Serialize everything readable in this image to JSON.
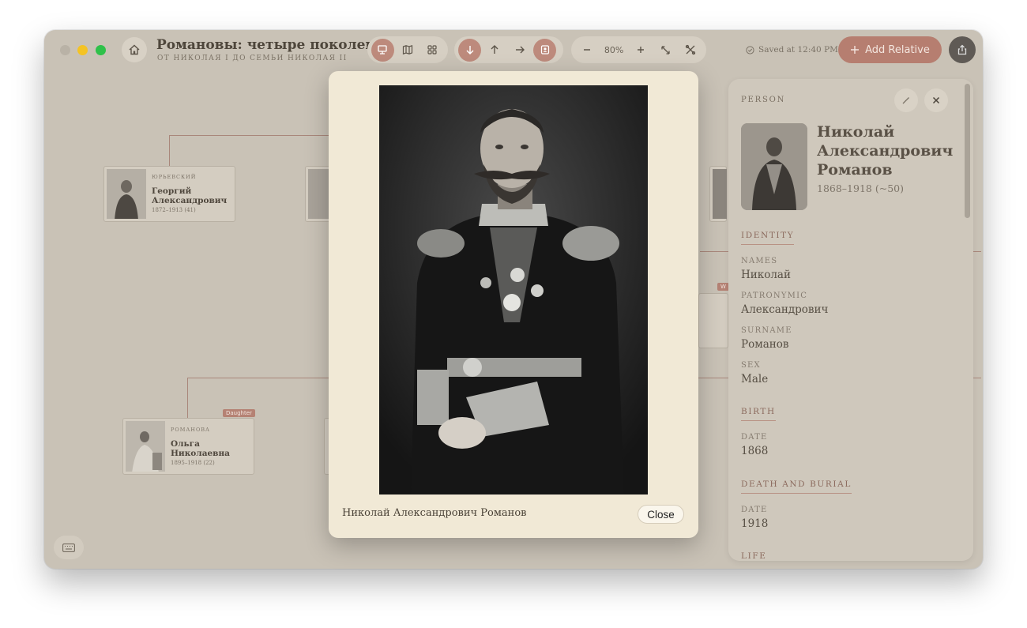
{
  "toolbar": {
    "title": "Романовы: четыре поколени…",
    "subtitle": "ОТ НИКОЛАЯ I ДО СЕМЬИ НИКОЛАЯ II",
    "zoom": "80%",
    "saved": "Saved at 12:40 PM",
    "add_relative": "Add Relative"
  },
  "tree": {
    "cards": [
      {
        "surname": "ЮРЬЕВСКИЙ",
        "name": "Георгий Александрович",
        "dates": "1872–1913 (41)"
      },
      {
        "surname": "РОМАНОВА",
        "name": "Ольга Николаевна",
        "dates": "1895–1918 (22)",
        "badge": "Daughter"
      }
    ],
    "partial_badge": "W"
  },
  "panel": {
    "kicker": "PERSON",
    "name": "Николай Александрович Романов",
    "dates": "1868–1918 (~50)",
    "sections": {
      "identity": "IDENTITY",
      "birth": "BIRTH",
      "death": "DEATH AND BURIAL",
      "life": "LIFE"
    },
    "fields": {
      "names_label": "NAMES",
      "names_value": "Николай",
      "patronymic_label": "PATRONYMIC",
      "patronymic_value": "Александрович",
      "surname_label": "SURNAME",
      "surname_value": "Романов",
      "sex_label": "SEX",
      "sex_value": "Male",
      "birth_date_label": "DATE",
      "birth_date_value": "1868",
      "death_date_label": "DATE",
      "death_date_value": "1918"
    }
  },
  "modal": {
    "caption": "Николай Александрович Романов",
    "close_label": "Close"
  }
}
